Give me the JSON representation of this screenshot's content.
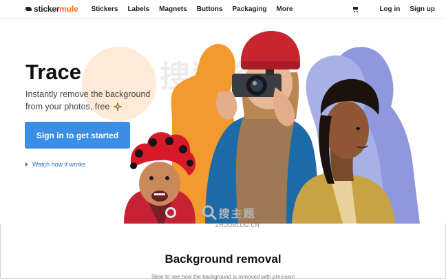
{
  "header": {
    "logo_part1": "sticker",
    "logo_part2": "mule",
    "nav": [
      "Stickers",
      "Labels",
      "Magnets",
      "Buttons",
      "Packaging",
      "More"
    ],
    "login": "Log in",
    "signup": "Sign up",
    "cart_icon": "cart-icon"
  },
  "hero": {
    "title": "Trace",
    "subtitle_line1": "Instantly remove the background",
    "subtitle_line2": "from your photos, free",
    "cta_label": "Sign in to get started",
    "watch_label": "Watch how it works",
    "watermark_cn": "搜狗资讯"
  },
  "watermark": {
    "cn": "搜主题",
    "url": "ZHOUBLOG.CN"
  },
  "section": {
    "title": "Background removal",
    "desc": "Slide to see how the background is removed with precision"
  },
  "colors": {
    "accent": "#ff6a1a",
    "button": "#3b8ee5",
    "link": "#2f6fb8",
    "silhouette_orange": "#f39a2e",
    "silhouette_blue": "#8f98dd"
  }
}
